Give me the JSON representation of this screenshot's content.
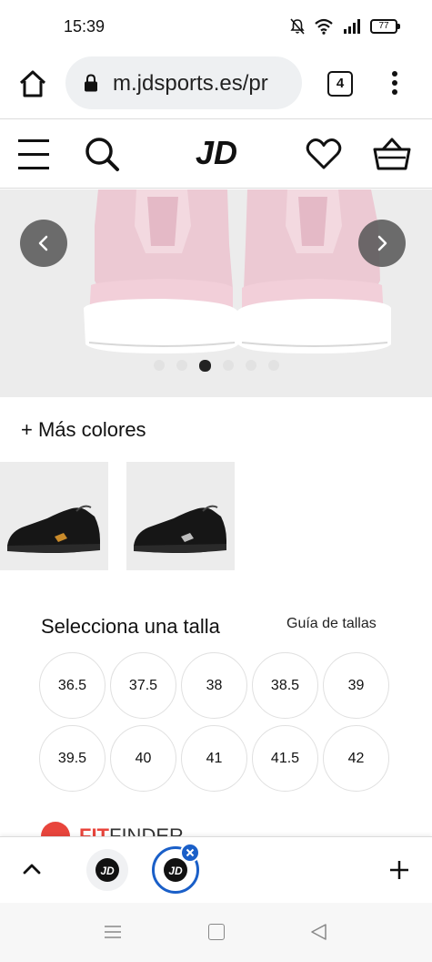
{
  "status_bar": {
    "time": "15:39",
    "battery": "77",
    "icons": [
      "mute-icon",
      "wifi-icon",
      "signal-icon",
      "battery-icon"
    ]
  },
  "browser": {
    "url": "m.jdsports.es/pr",
    "tab_count": "4"
  },
  "site": {
    "logo": "JD",
    "header_icons": [
      "hamburger-menu-icon",
      "search-icon",
      "heart-icon",
      "basket-icon"
    ]
  },
  "carousel": {
    "slide_count": 6,
    "active_index": 2
  },
  "more_colors": {
    "label": "+ Más colores",
    "thumbnails": [
      "black-shoe-orange-logo",
      "black-shoe-white-logo"
    ]
  },
  "size_selector": {
    "title": "Selecciona una talla",
    "guide_label": "Guía de tallas",
    "sizes": [
      "36.5",
      "37.5",
      "38",
      "38.5",
      "39",
      "39.5",
      "40",
      "41",
      "41.5",
      "42"
    ]
  },
  "fit_finder": {
    "bold": "FIT",
    "rest": "FINDER"
  },
  "tab_switcher": {
    "tabs": [
      "JD",
      "JD"
    ],
    "active_tab": 1
  },
  "colors": {
    "accent_blue": "#1a5fc8",
    "fit_red": "#e8453c",
    "carousel_bg": "#ececec"
  }
}
